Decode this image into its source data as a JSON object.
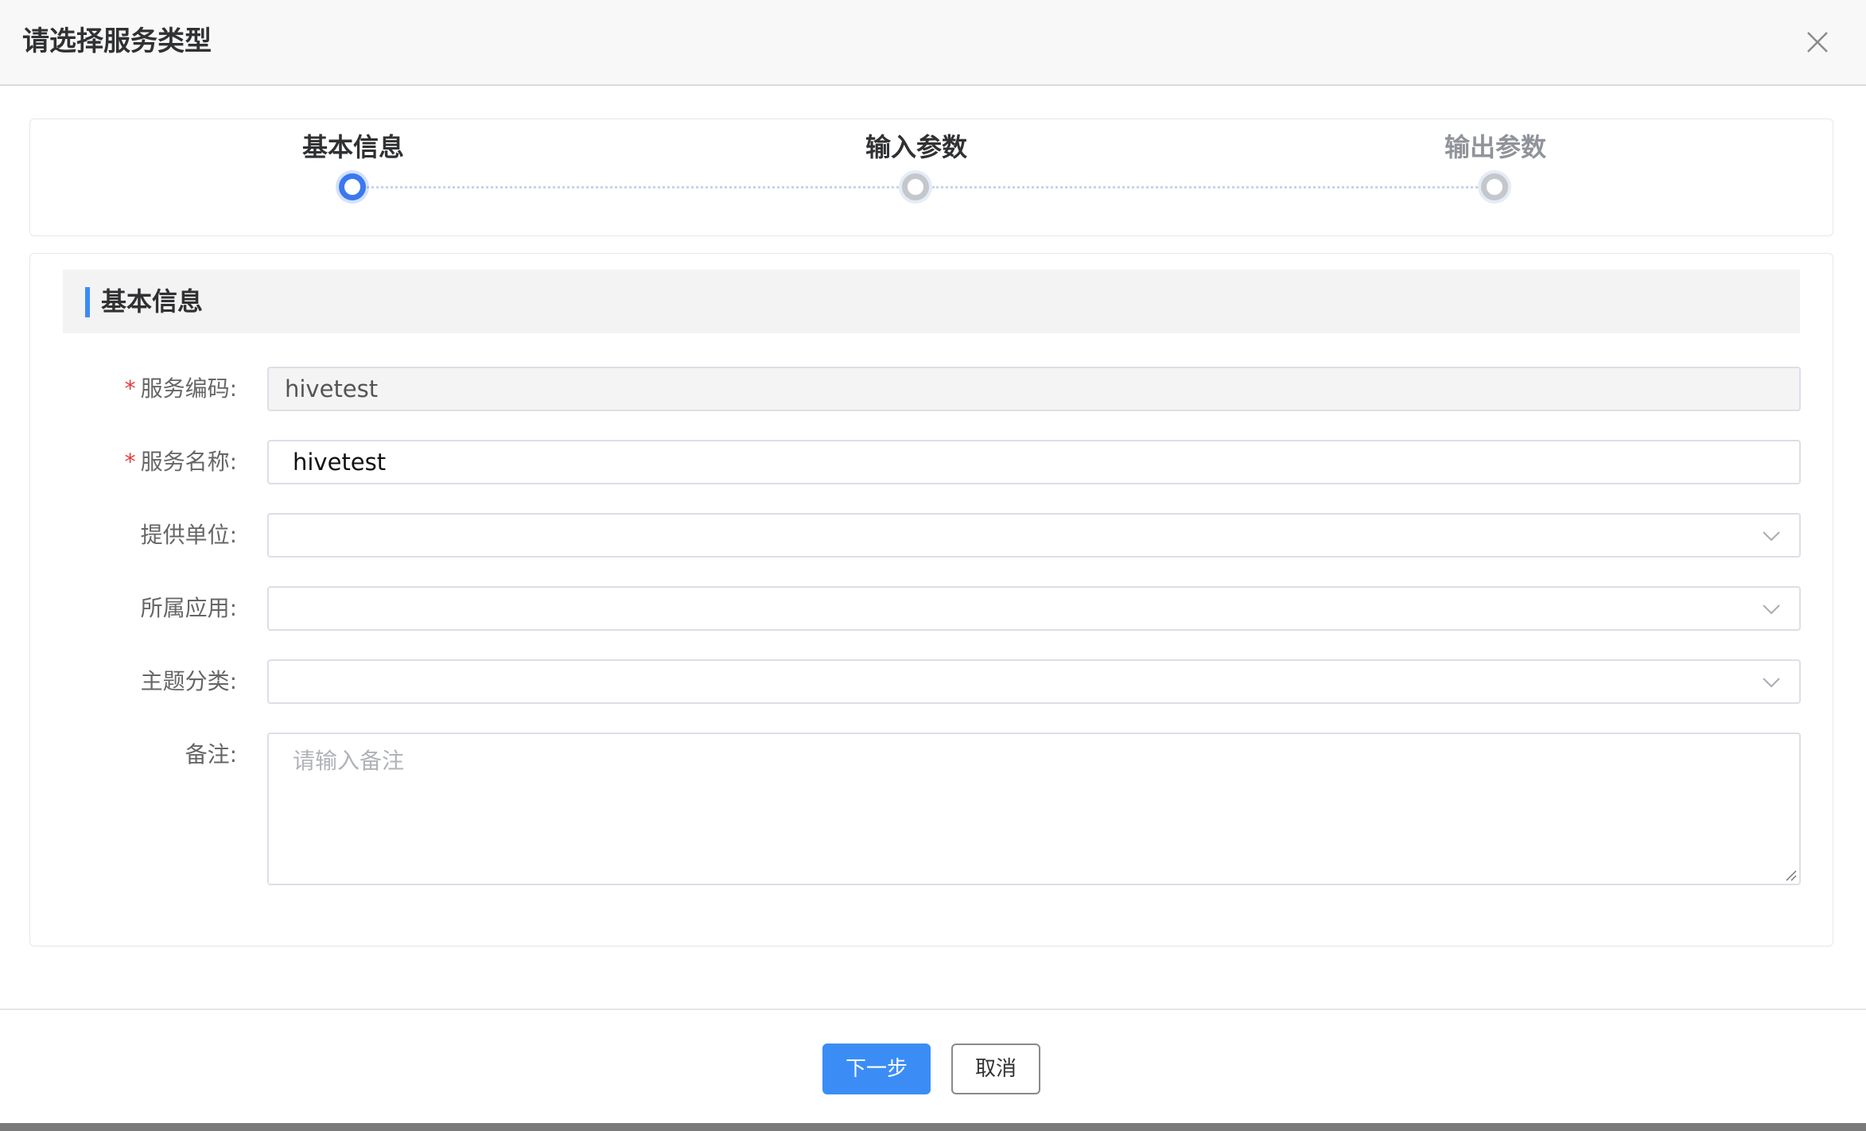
{
  "dialog": {
    "title": "请选择服务类型"
  },
  "steps": [
    {
      "label": "基本信息",
      "status": "active",
      "color": "#303133"
    },
    {
      "label": "输入参数",
      "status": "pending",
      "color": "#303133"
    },
    {
      "label": "输出参数",
      "status": "pending",
      "color": "#909399"
    }
  ],
  "section": {
    "title": "基本信息"
  },
  "form": {
    "service_code": {
      "label": "服务编码:",
      "value": "hivetest",
      "required": true,
      "disabled": true
    },
    "service_name": {
      "label": "服务名称:",
      "value": "hivetest",
      "required": true
    },
    "provider": {
      "label": "提供单位:",
      "value": ""
    },
    "application": {
      "label": "所属应用:",
      "value": ""
    },
    "topic": {
      "label": "主题分类:",
      "value": ""
    },
    "remark": {
      "label": "备注:",
      "placeholder": "请输入备注"
    }
  },
  "footer": {
    "next_label": "下一步",
    "cancel_label": "取消"
  },
  "colors": {
    "accent": "#3b8df5",
    "step_active": "#3b78f0",
    "required": "#e43b3b"
  },
  "icons": {
    "close": "close-icon",
    "dropdown": "chevron-down-icon"
  }
}
